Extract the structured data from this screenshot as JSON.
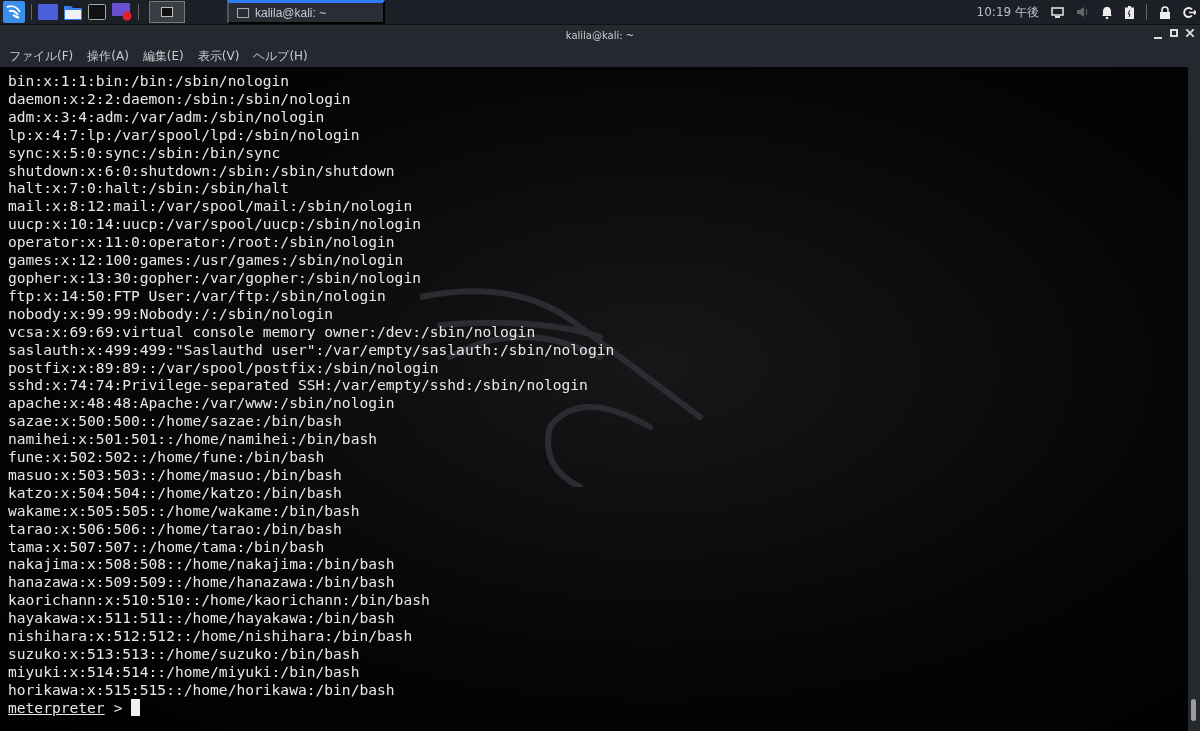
{
  "panel": {
    "tasks": [
      {
        "title": "kalila@kali: ~",
        "selected": true
      }
    ],
    "clock": "10:19 午後"
  },
  "window": {
    "title": "kalila@kali: ~"
  },
  "menu": [
    "ファイル(F)",
    "操作(A)",
    "編集(E)",
    "表示(V)",
    "ヘルプ(H)"
  ],
  "terminal": {
    "lines": [
      "bin:x:1:1:bin:/bin:/sbin/nologin",
      "daemon:x:2:2:daemon:/sbin:/sbin/nologin",
      "adm:x:3:4:adm:/var/adm:/sbin/nologin",
      "lp:x:4:7:lp:/var/spool/lpd:/sbin/nologin",
      "sync:x:5:0:sync:/sbin:/bin/sync",
      "shutdown:x:6:0:shutdown:/sbin:/sbin/shutdown",
      "halt:x:7:0:halt:/sbin:/sbin/halt",
      "mail:x:8:12:mail:/var/spool/mail:/sbin/nologin",
      "uucp:x:10:14:uucp:/var/spool/uucp:/sbin/nologin",
      "operator:x:11:0:operator:/root:/sbin/nologin",
      "games:x:12:100:games:/usr/games:/sbin/nologin",
      "gopher:x:13:30:gopher:/var/gopher:/sbin/nologin",
      "ftp:x:14:50:FTP User:/var/ftp:/sbin/nologin",
      "nobody:x:99:99:Nobody:/:/sbin/nologin",
      "vcsa:x:69:69:virtual console memory owner:/dev:/sbin/nologin",
      "saslauth:x:499:499:\"Saslauthd user\":/var/empty/saslauth:/sbin/nologin",
      "postfix:x:89:89::/var/spool/postfix:/sbin/nologin",
      "sshd:x:74:74:Privilege-separated SSH:/var/empty/sshd:/sbin/nologin",
      "apache:x:48:48:Apache:/var/www:/sbin/nologin",
      "sazae:x:500:500::/home/sazae:/bin/bash",
      "namihei:x:501:501::/home/namihei:/bin/bash",
      "fune:x:502:502::/home/fune:/bin/bash",
      "masuo:x:503:503::/home/masuo:/bin/bash",
      "katzo:x:504:504::/home/katzo:/bin/bash",
      "wakame:x:505:505::/home/wakame:/bin/bash",
      "tarao:x:506:506::/home/tarao:/bin/bash",
      "tama:x:507:507::/home/tama:/bin/bash",
      "nakajima:x:508:508::/home/nakajima:/bin/bash",
      "hanazawa:x:509:509::/home/hanazawa:/bin/bash",
      "kaorichann:x:510:510::/home/kaorichann:/bin/bash",
      "hayakawa:x:511:511::/home/hayakawa:/bin/bash",
      "nishihara:x:512:512::/home/nishihara:/bin/bash",
      "suzuko:x:513:513::/home/suzuko:/bin/bash",
      "miyuki:x:514:514::/home/miyuki:/bin/bash",
      "horikawa:x:515:515::/home/horikawa:/bin/bash"
    ],
    "prompt": "meterpreter",
    "prompt_symbol": ">"
  }
}
